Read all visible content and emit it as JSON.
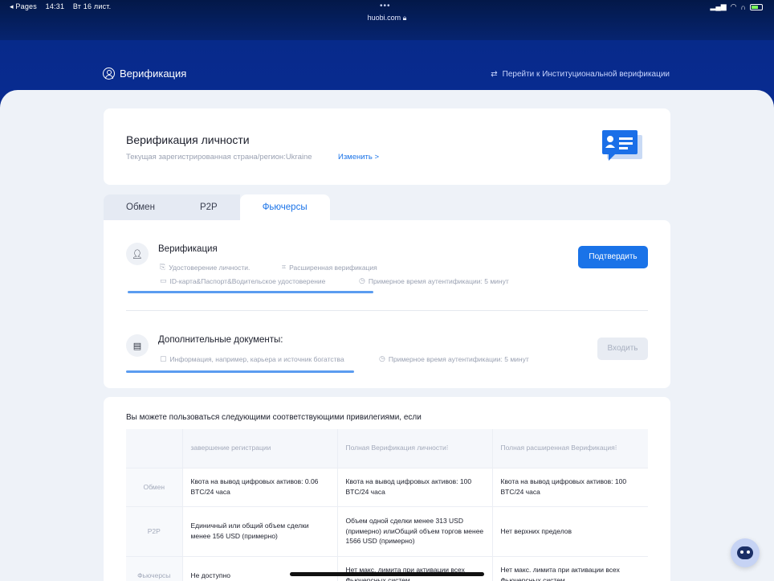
{
  "statusbar": {
    "back_app": "◂ Pages",
    "time": "14:31",
    "date": "Вт 16 лист.",
    "url": "huobi.com",
    "dots": "•••",
    "signal": "▪▪▮",
    "wifi": "wifi",
    "headphones": "🎧"
  },
  "hero": {
    "title": "Верификация",
    "institution_link": "Перейти к Институциональной верификации"
  },
  "identity": {
    "title": "Верификация личности",
    "subtitle": "Текущая зарегистрированная страна/регион:Ukraine",
    "change_label": "Изменить >"
  },
  "tabs": [
    {
      "label": "Обмен"
    },
    {
      "label": "P2P"
    },
    {
      "label": "Фьючерсы"
    }
  ],
  "verification": {
    "title": "Верификация",
    "item1": "Удостоверение личности.",
    "item2": "Расширенная верификация",
    "item3": "ID-карта&Паспорт&Водительское удостоверение",
    "time": "Примерное время аутентификации: 5 минут",
    "button": "Подтвердить"
  },
  "documents": {
    "title": "Дополнительные документы:",
    "item1": "Информация, например, карьера и источник богатства",
    "time": "Примерное время аутентификации: 5 минут",
    "button": "Входить"
  },
  "privileges": {
    "title": "Вы можете пользоваться следующими соответствующими привилегиями, если",
    "headers": [
      "",
      "завершение регистрации",
      "Полная Верификация личности⁝",
      "Полная расширенная Верификация⁝"
    ],
    "rows": [
      {
        "label": "Обмен",
        "cells": [
          "Квота на вывод цифровых активов: 0.06 BTC/24 часа",
          "Квота на вывод цифровых активов: 100 BTC/24 часа",
          "Квота на вывод цифровых активов: 100 BTC/24 часа"
        ]
      },
      {
        "label": "P2P",
        "cells": [
          "Единичный или общий объем сделки менее 156 USD (примерно)",
          "Объем одной сделки менее 313 USD (примерно) илиОбщий объем торгов менее 1566 USD (примерно)",
          "Нет верхних пределов"
        ]
      },
      {
        "label": "Фьючерсы",
        "cells": [
          "Не доступно",
          "Нет макс. лимита при активации всех Фьючерсных систем",
          "Нет макс. лимита при активации всех Фьючерсных систем"
        ]
      }
    ]
  }
}
